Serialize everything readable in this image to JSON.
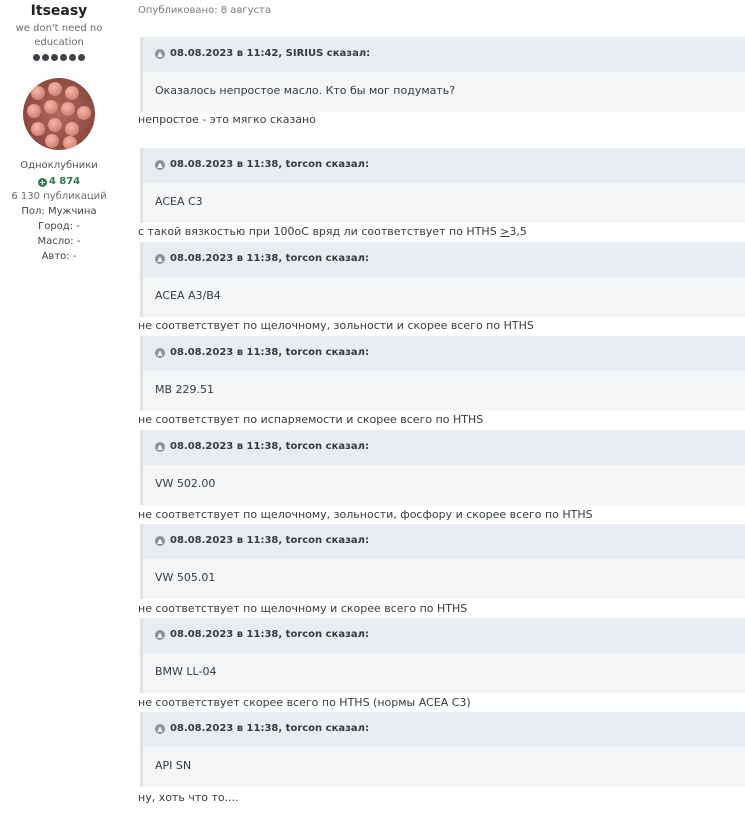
{
  "author": {
    "name": "Itseasy",
    "title": "we don't need no education",
    "group": "Одноклубники",
    "reputation": "4 874",
    "posts": "6 130 публикаций",
    "fields": [
      {
        "label": "Пол:",
        "value": "Мужчина"
      },
      {
        "label": "Город:",
        "value": "-"
      },
      {
        "label": "Масло:",
        "value": "-"
      },
      {
        "label": "Авто:",
        "value": "-"
      }
    ]
  },
  "post": {
    "published": "Опубликовано: 8 августа",
    "quotes": [
      {
        "header": "08.08.2023 в 11:42, SIRIUS сказал:",
        "body": "Оказалось непростое масло. Кто бы мог подумать?",
        "reply": "непростое - это мягко сказано"
      },
      {
        "header": "08.08.2023 в 11:38, torcon сказал:",
        "body": "ACEA C3",
        "reply_pre": "с такой вязкостью при 100оС вряд ли соответствует по HTHS ",
        "reply_u": ">",
        "reply_post": "3,5"
      },
      {
        "header": "08.08.2023 в 11:38, torcon сказал:",
        "body": "ACEA A3/B4",
        "reply": "не соответствует по щелочному, зольности и скорее всего по HTHS"
      },
      {
        "header": "08.08.2023 в 11:38, torcon сказал:",
        "body": "MB 229.51",
        "reply": "не соответствует по испаряемости и скорее всего по HTHS"
      },
      {
        "header": "08.08.2023 в 11:38, torcon сказал:",
        "body": "VW 502.00",
        "reply": "не соответствует по щелочному, зольности, фосфору и скорее всего по HTHS"
      },
      {
        "header": "08.08.2023 в 11:38, torcon сказал:",
        "body": "VW 505.01",
        "reply": "не соответствует по щелочному и скорее всего по HTHS"
      },
      {
        "header": "08.08.2023 в 11:38, torcon сказал:",
        "body": "BMW LL-04",
        "reply": "не соответствует скорее всего по HTHS (нормы ACEA C3)"
      },
      {
        "header": "08.08.2023 в 11:38, torcon сказал:",
        "body": "API SN",
        "reply": "ну, хоть что то...."
      }
    ]
  }
}
